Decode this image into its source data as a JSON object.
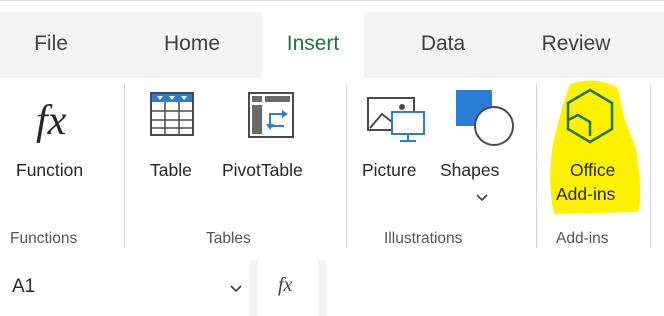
{
  "tabs": [
    "File",
    "Home",
    "Insert",
    "Data",
    "Review"
  ],
  "active_tab": "Insert",
  "colors": {
    "accent_green": "#217346",
    "highlight_yellow": "#fff200",
    "icon_blue": "#2b7cd3",
    "icon_dark": "#4a4a4a"
  },
  "ribbon": {
    "function_label": "Function",
    "table_label": "Table",
    "pivottable_label": "PivotTable",
    "picture_label": "Picture",
    "shapes_label": "Shapes",
    "office_addins_line1": "Office",
    "office_addins_line2": "Add-ins",
    "groups": {
      "functions": "Functions",
      "tables": "Tables",
      "illustrations": "Illustrations",
      "addins": "Add-ins"
    },
    "icons": {
      "function": "fx-icon",
      "table": "table-icon",
      "pivottable": "pivottable-icon",
      "picture": "picture-icon",
      "shapes": "shapes-icon",
      "office_addins": "hexagon-addins-icon"
    }
  },
  "formula_bar": {
    "name_box_value": "A1",
    "fx_label": "fx",
    "formula_value": ""
  }
}
